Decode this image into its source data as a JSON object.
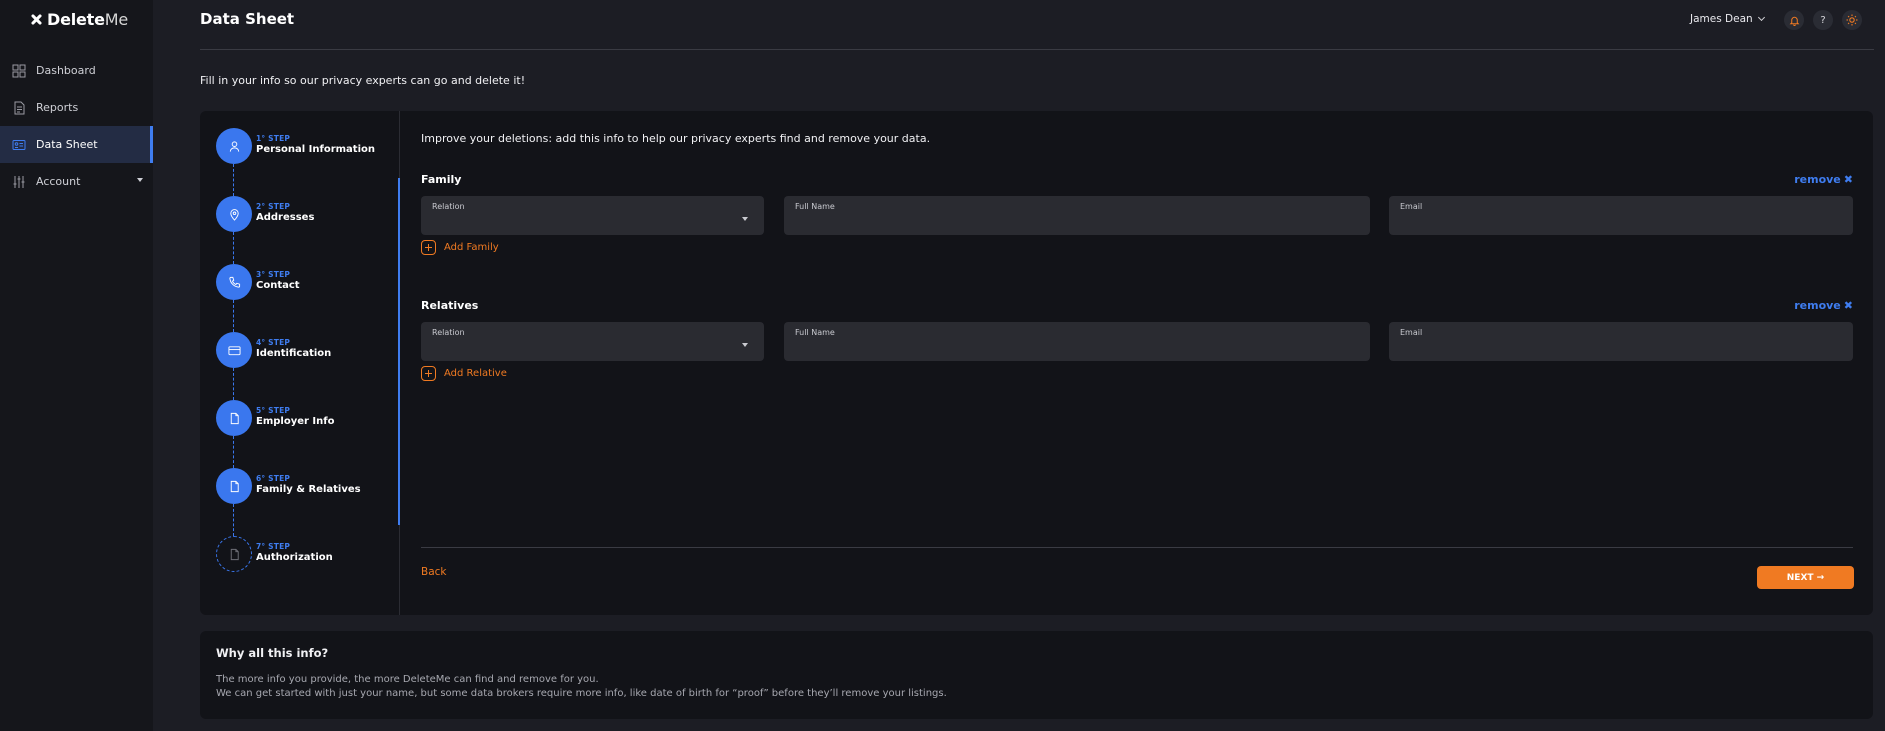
{
  "app": {
    "logo_main": "Delete",
    "logo_suffix": "Me"
  },
  "sidebar": {
    "items": [
      {
        "label": "Dashboard",
        "icon": "grid-icon"
      },
      {
        "label": "Reports",
        "icon": "document-icon"
      },
      {
        "label": "Data Sheet",
        "icon": "id-card-icon",
        "active": true
      },
      {
        "label": "Account",
        "icon": "sliders-icon",
        "has_caret": true
      }
    ]
  },
  "header": {
    "title": "Data Sheet",
    "user_name": "James Dean",
    "icons": [
      "bell-icon",
      "help-icon",
      "sun-icon"
    ],
    "help_glyph": "?"
  },
  "intro": "Fill in your info so our privacy experts can go and delete it!",
  "steps": [
    {
      "num": "1° STEP",
      "label": "Personal Information",
      "icon": "user-icon"
    },
    {
      "num": "2° STEP",
      "label": "Addresses",
      "icon": "map-pin-icon"
    },
    {
      "num": "3° STEP",
      "label": "Contact",
      "icon": "phone-icon"
    },
    {
      "num": "4° STEP",
      "label": "Identification",
      "icon": "card-icon"
    },
    {
      "num": "5° STEP",
      "label": "Employer Info",
      "icon": "file-icon"
    },
    {
      "num": "6° STEP",
      "label": "Family & Relatives",
      "icon": "file-icon"
    },
    {
      "num": "7° STEP",
      "label": "Authorization",
      "icon": "file-icon",
      "pending": true
    }
  ],
  "form": {
    "intro": "Improve your deletions: add this info to help our privacy experts find and remove your data.",
    "family": {
      "title": "Family",
      "remove_label": "remove",
      "relation_label": "Relation",
      "relation_value": "",
      "fullname_label": "Full Name",
      "fullname_value": "",
      "email_label": "Email",
      "email_value": "",
      "add_label": "Add Family"
    },
    "relatives": {
      "title": "Relatives",
      "remove_label": "remove",
      "relation_label": "Relation",
      "relation_value": "",
      "fullname_label": "Full Name",
      "fullname_value": "",
      "email_label": "Email",
      "email_value": "",
      "add_label": "Add Relative"
    },
    "back_label": "Back",
    "next_label": "NEXT",
    "next_arrow": "→",
    "remove_glyph": "✖"
  },
  "why": {
    "title": "Why all this info?",
    "line1": "The more info you provide, the more DeleteMe can find and remove for you.",
    "line2": "We can get started with just your name, but some data brokers require more info, like date of birth for “proof” before they’ll remove your listings."
  },
  "colors": {
    "accent_blue": "#3f7df0",
    "accent_orange": "#f07a22",
    "background": "#1c1d24",
    "card": "#121318"
  }
}
